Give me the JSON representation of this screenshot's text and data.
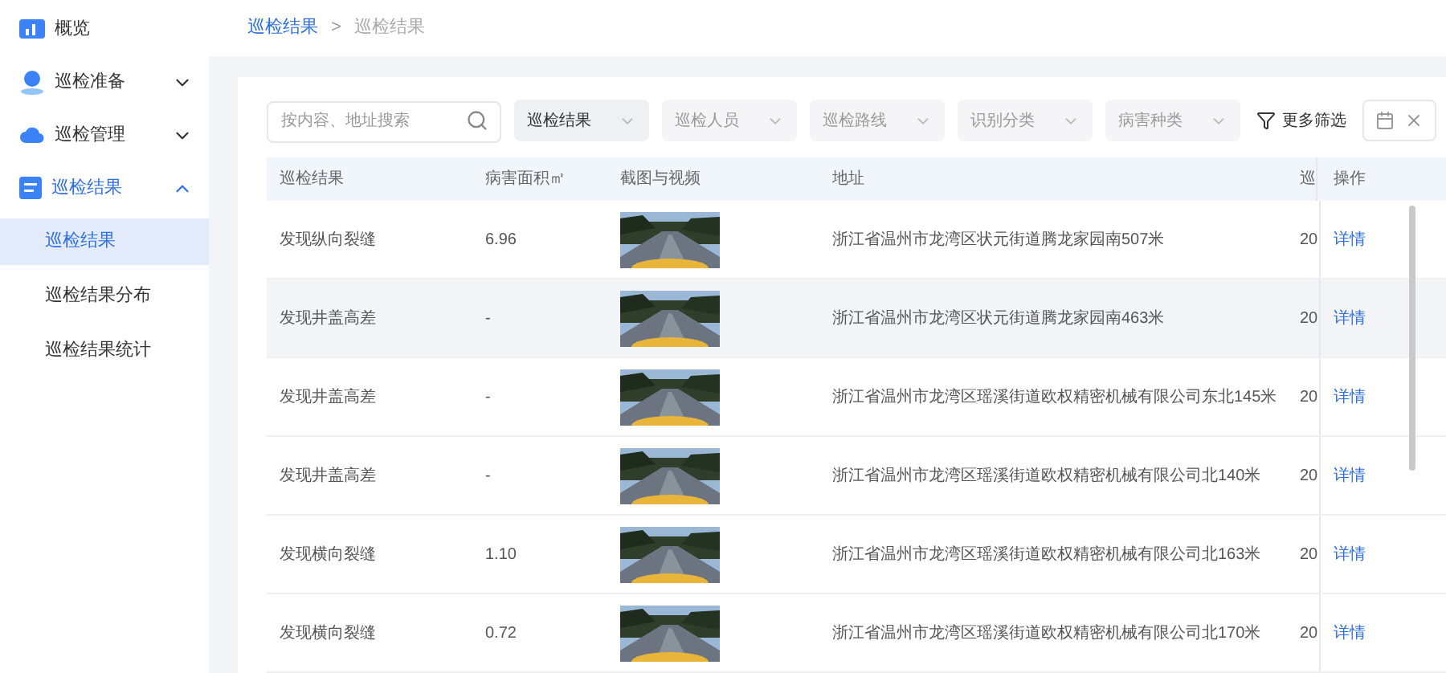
{
  "sidebar": {
    "items": [
      {
        "label": "概览",
        "kind": "link",
        "active": false
      },
      {
        "label": "巡检准备",
        "kind": "group",
        "expanded": false,
        "active": false
      },
      {
        "label": "巡检管理",
        "kind": "group",
        "expanded": false,
        "active": false
      },
      {
        "label": "巡检结果",
        "kind": "group",
        "expanded": true,
        "active": true,
        "children": [
          {
            "label": "巡检结果",
            "selected": true
          },
          {
            "label": "巡检结果分布",
            "selected": false
          },
          {
            "label": "巡检结果统计",
            "selected": false
          }
        ]
      }
    ]
  },
  "breadcrumb": [
    {
      "label": "巡检结果",
      "current": false
    },
    {
      "label": ">",
      "kind": "separator"
    },
    {
      "label": "巡检结果",
      "current": true
    }
  ],
  "filters": {
    "search": {
      "placeholder": "按内容、地址搜索"
    },
    "selects": [
      {
        "label": "巡检结果",
        "disabled": false
      },
      {
        "label": "巡检人员",
        "disabled": true
      },
      {
        "label": "巡检路线",
        "disabled": true
      },
      {
        "label": "识别分类",
        "disabled": true
      },
      {
        "label": "病害种类",
        "disabled": true
      }
    ],
    "more": "更多筛选"
  },
  "table": {
    "columns": [
      "巡检结果",
      "病害面积㎡",
      "截图与视频",
      "地址",
      "巡",
      "操作"
    ],
    "rows": [
      {
        "result": "发现纵向裂缝",
        "area": "6.96",
        "address": "浙江省温州市龙湾区状元街道腾龙家园南507米",
        "column_5": "20",
        "action": "详情",
        "highlighted": false
      },
      {
        "result": "发现井盖高差",
        "area": "-",
        "address": "浙江省温州市龙湾区状元街道腾龙家园南463米",
        "column_5": "20",
        "action": "详情",
        "highlighted": true
      },
      {
        "result": "发现井盖高差",
        "area": "-",
        "address": "浙江省温州市龙湾区瑶溪街道欧权精密机械有限公司东北145米",
        "column_5": "20",
        "action": "详情",
        "highlighted": false
      },
      {
        "result": "发现井盖高差",
        "area": "-",
        "address": "浙江省温州市龙湾区瑶溪街道欧权精密机械有限公司北140米",
        "column_5": "20",
        "action": "详情",
        "highlighted": false
      },
      {
        "result": "发现横向裂缝",
        "area": "1.10",
        "address": "浙江省温州市龙湾区瑶溪街道欧权精密机械有限公司北163米",
        "column_5": "20",
        "action": "详情",
        "highlighted": false
      },
      {
        "result": "发现横向裂缝",
        "area": "0.72",
        "address": "浙江省温州市龙湾区瑶溪街道欧权精密机械有限公司北170米",
        "column_5": "20",
        "action": "详情",
        "highlighted": false
      }
    ]
  }
}
